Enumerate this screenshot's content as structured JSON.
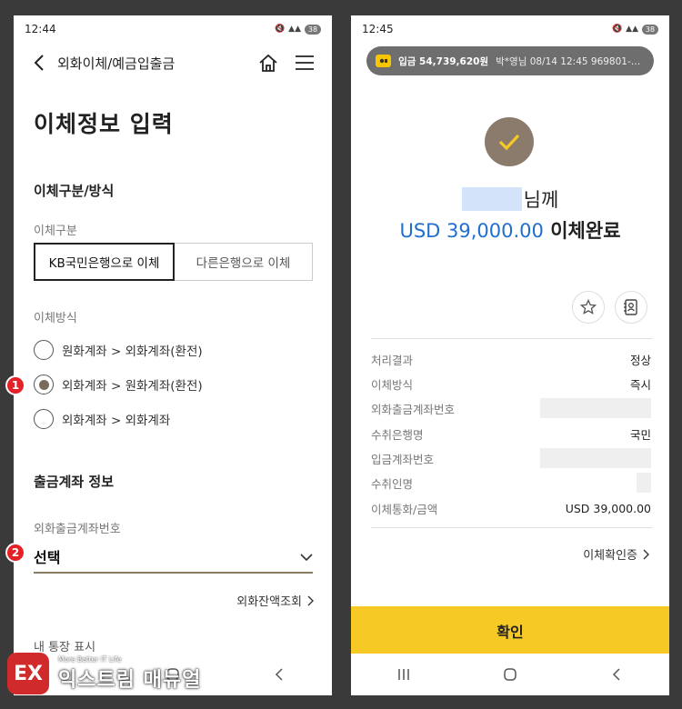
{
  "left": {
    "status": {
      "time": "12:44",
      "battery": "38"
    },
    "nav": {
      "title": "외화이체/예금입출금"
    },
    "page_title": "이체정보 입력",
    "section1": "이체구분/방식",
    "transfer_type_label": "이체구분",
    "transfer_types": {
      "kb": "KB국민은행으로 이체",
      "other": "다른은행으로 이체"
    },
    "method_label": "이체방식",
    "methods": [
      "원화계좌 > 외화계좌(환전)",
      "외화계좌 > 원화계좌(환전)",
      "외화계좌 > 외화계좌"
    ],
    "badges": [
      "1",
      "2"
    ],
    "section2": "출금계좌 정보",
    "account_label": "외화출금계좌번호",
    "account_value": "선택",
    "balance_link": "외화잔액조회",
    "partial_section": "내 통장 표시"
  },
  "right": {
    "status": {
      "time": "12:45",
      "battery": "38"
    },
    "notification": {
      "bold": "입금 54,739,620원",
      "rest": "박*영님 08/14 12:45 969801-**-···"
    },
    "recipient_suffix": "님께",
    "amount": "USD 39,000.00",
    "amount_suffix": "이체완료",
    "rows": [
      {
        "label": "처리결과",
        "value": "정상"
      },
      {
        "label": "이체방식",
        "value": "즉시"
      },
      {
        "label": "외화출금계좌번호",
        "value": ""
      },
      {
        "label": "수취은행명",
        "value": "국민"
      },
      {
        "label": "입금계좌번호",
        "value": ""
      },
      {
        "label": "수취인명",
        "value": ""
      },
      {
        "label": "이체통화/금액",
        "value": "USD 39,000.00"
      }
    ],
    "confirm_link": "이체확인증",
    "confirm_button": "확인"
  },
  "watermark": {
    "tagline": "More Better IT Life",
    "name": "익스트림 매뉴얼"
  },
  "colors": {
    "accent_yellow": "#f7c924",
    "brown": "#8b7b6c",
    "blue_amount": "#1e6fd0",
    "badge_red": "#e52126"
  }
}
